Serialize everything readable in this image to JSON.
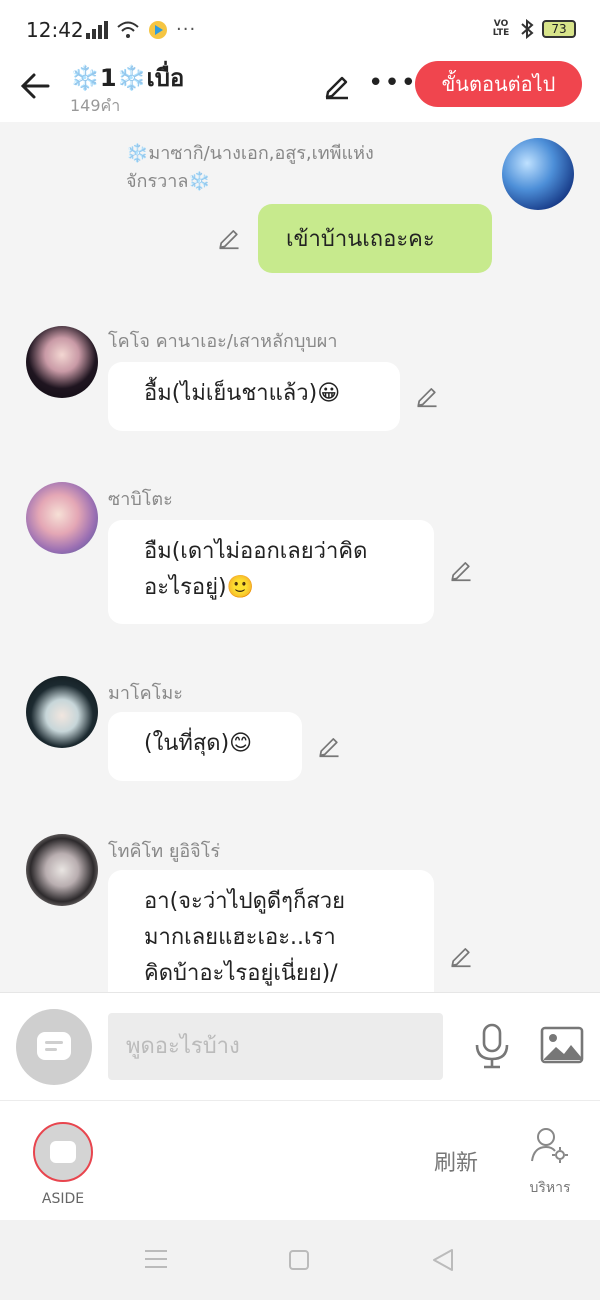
{
  "status_bar": {
    "time": "12:42",
    "dots": "···",
    "volte": "VO LTE",
    "battery": "73"
  },
  "header": {
    "title_prefix_icon": "❄️",
    "title_number": "1",
    "title_mid_icon": "❄️",
    "title_text": "เบื่อ",
    "subtitle": "149คำ",
    "next_button": "ขั้นตอนต่อไป"
  },
  "messages": [
    {
      "sender": "❄️มาซากิ/นางเอก,อสูร,เทพีแห่งจักรวาล❄️",
      "lines": [
        "เข้าบ้านเถอะคะ"
      ],
      "mine": true
    },
    {
      "sender": "โคโจ คานาเอะ/เสาหลักบุบผา",
      "lines": [
        "อื้ม(ไม่เย็นชาแล้ว)😀"
      ],
      "mine": false
    },
    {
      "sender": "ซาบิโตะ",
      "lines": [
        "อืม(เดาไม่ออกเลยว่าคิด",
        "อะไรอยู่)🙂"
      ],
      "mine": false
    },
    {
      "sender": "มาโคโมะ",
      "lines": [
        "(ในที่สุด)😊"
      ],
      "mine": false
    },
    {
      "sender": "โทคิโท ยูอิจิโร่",
      "lines": [
        "อา(จะว่าไปดูดีๆก็สวย",
        "มากเลยแฮะเอะ..เรา",
        "คิดบ้าอะไรอยู่เนี่ยย)/"
      ],
      "mine": false
    }
  ],
  "input_bar": {
    "placeholder": "พูดอะไรบ้าง"
  },
  "toolbar": {
    "aside_label": "ASIDE",
    "refresh_label": "刷新",
    "manage_label": "บริหาร"
  },
  "colors": {
    "accent": "#f0454e",
    "my_bubble": "#c7ea8d",
    "background": "#f4f4f4"
  },
  "icons": [
    "back-arrow-icon",
    "pencil-icon",
    "more-icon",
    "microphone-icon",
    "image-icon",
    "chat-bubble-icon",
    "manage-user-icon"
  ]
}
